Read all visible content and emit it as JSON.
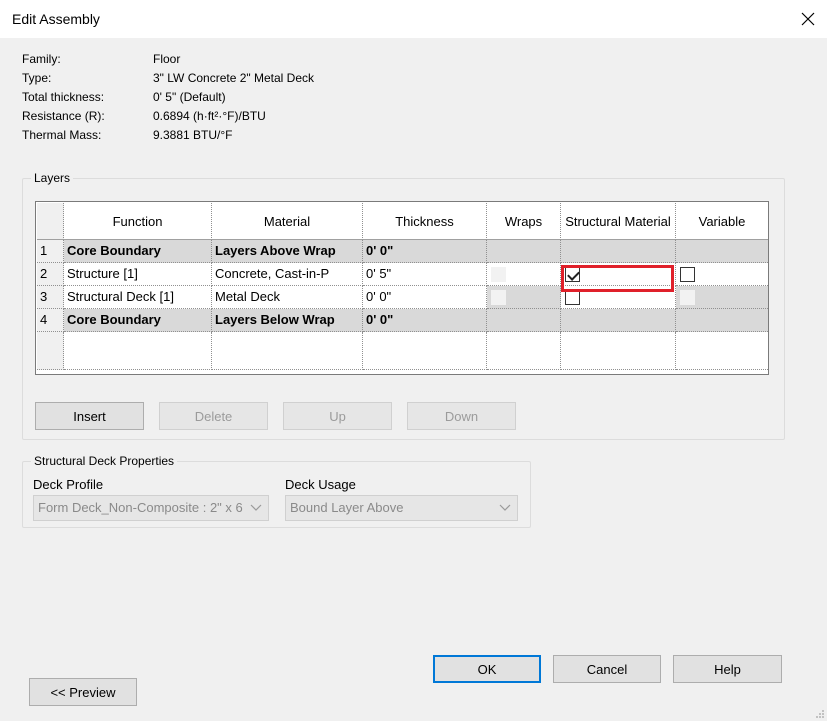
{
  "window": {
    "title": "Edit Assembly"
  },
  "info": {
    "family_label": "Family:",
    "family_value": "Floor",
    "type_label": "Type:",
    "type_value": "3\" LW Concrete 2\" Metal Deck",
    "thickness_label": "Total thickness:",
    "thickness_value": "0'  5\" (Default)",
    "resistance_label": "Resistance (R):",
    "resistance_value": "0.6894 (h·ft²·°F)/BTU",
    "mass_label": "Thermal Mass:",
    "mass_value": "9.3881 BTU/°F"
  },
  "layers": {
    "legend": "Layers",
    "columns": {
      "function": "Function",
      "material": "Material",
      "thickness": "Thickness",
      "wraps": "Wraps",
      "structural": "Structural Material",
      "variable": "Variable"
    },
    "rows": [
      {
        "idx": "1",
        "function": "Core Boundary",
        "material": "Layers Above Wrap",
        "thickness": "0'  0\""
      },
      {
        "idx": "2",
        "function": "Structure [1]",
        "material": "Concrete, Cast-in-P",
        "thickness": "0'  5\"",
        "structural_checked": true
      },
      {
        "idx": "3",
        "function": "Structural Deck [1]",
        "material": "Metal Deck",
        "thickness": "0'  0\"",
        "structural_checked": false
      },
      {
        "idx": "4",
        "function": "Core Boundary",
        "material": "Layers Below Wrap",
        "thickness": "0'  0\""
      }
    ]
  },
  "buttons": {
    "insert": "Insert",
    "delete": "Delete",
    "up": "Up",
    "down": "Down",
    "ok": "OK",
    "cancel": "Cancel",
    "help": "Help",
    "preview": "<< Preview"
  },
  "deck": {
    "legend": "Structural Deck Properties",
    "profile_label": "Deck Profile",
    "profile_value": "Form Deck_Non-Composite : 2\" x 6",
    "usage_label": "Deck Usage",
    "usage_value": "Bound Layer Above"
  },
  "colors": {
    "highlight": "#e0202a",
    "accent": "#0078d7"
  }
}
